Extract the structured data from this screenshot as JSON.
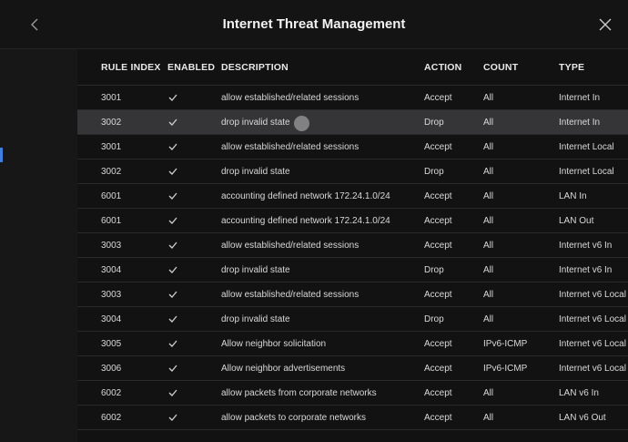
{
  "header": {
    "title": "Internet Threat Management",
    "back_icon": "chevron-left-icon",
    "close_icon": "close-icon"
  },
  "table": {
    "columns": [
      "RULE INDEX",
      "ENABLED",
      "DESCRIPTION",
      "ACTION",
      "COUNT",
      "TYPE"
    ],
    "rows": [
      {
        "index": "3001",
        "enabled": true,
        "description": "allow established/related sessions",
        "action": "Accept",
        "count": "All",
        "type": "Internet In"
      },
      {
        "index": "3002",
        "enabled": true,
        "description": "drop invalid state",
        "action": "Drop",
        "count": "All",
        "type": "Internet In",
        "highlighted": true
      },
      {
        "index": "3001",
        "enabled": true,
        "description": "allow established/related sessions",
        "action": "Accept",
        "count": "All",
        "type": "Internet Local"
      },
      {
        "index": "3002",
        "enabled": true,
        "description": "drop invalid state",
        "action": "Drop",
        "count": "All",
        "type": "Internet Local"
      },
      {
        "index": "6001",
        "enabled": true,
        "description": "accounting defined network 172.24.1.0/24",
        "action": "Accept",
        "count": "All",
        "type": "LAN In"
      },
      {
        "index": "6001",
        "enabled": true,
        "description": "accounting defined network 172.24.1.0/24",
        "action": "Accept",
        "count": "All",
        "type": "LAN Out"
      },
      {
        "index": "3003",
        "enabled": true,
        "description": "allow established/related sessions",
        "action": "Accept",
        "count": "All",
        "type": "Internet v6 In"
      },
      {
        "index": "3004",
        "enabled": true,
        "description": "drop invalid state",
        "action": "Drop",
        "count": "All",
        "type": "Internet v6 In"
      },
      {
        "index": "3003",
        "enabled": true,
        "description": "allow established/related sessions",
        "action": "Accept",
        "count": "All",
        "type": "Internet v6 Local"
      },
      {
        "index": "3004",
        "enabled": true,
        "description": "drop invalid state",
        "action": "Drop",
        "count": "All",
        "type": "Internet v6 Local"
      },
      {
        "index": "3005",
        "enabled": true,
        "description": "Allow neighbor solicitation",
        "action": "Accept",
        "count": "IPv6-ICMP",
        "type": "Internet v6 Local"
      },
      {
        "index": "3006",
        "enabled": true,
        "description": "Allow neighbor advertisements",
        "action": "Accept",
        "count": "IPv6-ICMP",
        "type": "Internet v6 Local"
      },
      {
        "index": "6002",
        "enabled": true,
        "description": "allow packets from corporate networks",
        "action": "Accept",
        "count": "All",
        "type": "LAN v6 In"
      },
      {
        "index": "6002",
        "enabled": true,
        "description": "allow packets to corporate networks",
        "action": "Accept",
        "count": "All",
        "type": "LAN v6 Out"
      }
    ]
  },
  "colors": {
    "background": "#121213",
    "highlight_row": "#353537",
    "accent": "#3f7fe0"
  }
}
